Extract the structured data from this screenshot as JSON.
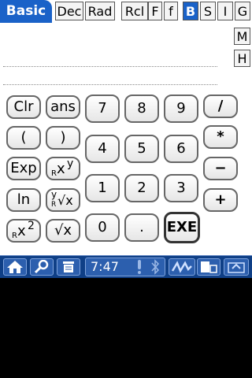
{
  "tabs": {
    "mode": "Basic",
    "dec": "Dec",
    "rad": "Rad",
    "rcl": "Rcl",
    "F": "F",
    "f": "f",
    "B": "B",
    "S": "S",
    "I": "I",
    "G": "G"
  },
  "side": {
    "M": "M",
    "H": "H"
  },
  "keys": {
    "clr": "Clr",
    "ans": "ans",
    "lparen": "(",
    "rparen": ")",
    "exp": "Exp",
    "xpow_y": "y",
    "xpow_x": "x",
    "xpow_sub": "R",
    "ln": "ln",
    "yroot_y": "y",
    "yroot_x": "√x",
    "yroot_sub": "R",
    "xsq_x": "x",
    "xsq_2": "2",
    "xsq_sub": "R",
    "sqrt": "√x",
    "n7": "7",
    "n8": "8",
    "n9": "9",
    "n4": "4",
    "n5": "5",
    "n6": "6",
    "n1": "1",
    "n2": "2",
    "n3": "3",
    "n0": "0",
    "dot": ".",
    "exe": "EXE",
    "div": "/",
    "mul": "*",
    "sub": "−",
    "add": "+"
  },
  "taskbar": {
    "clock": "7:47"
  },
  "colors": {
    "accent": "#1a62c8",
    "taskbar": "#0f3f86"
  }
}
